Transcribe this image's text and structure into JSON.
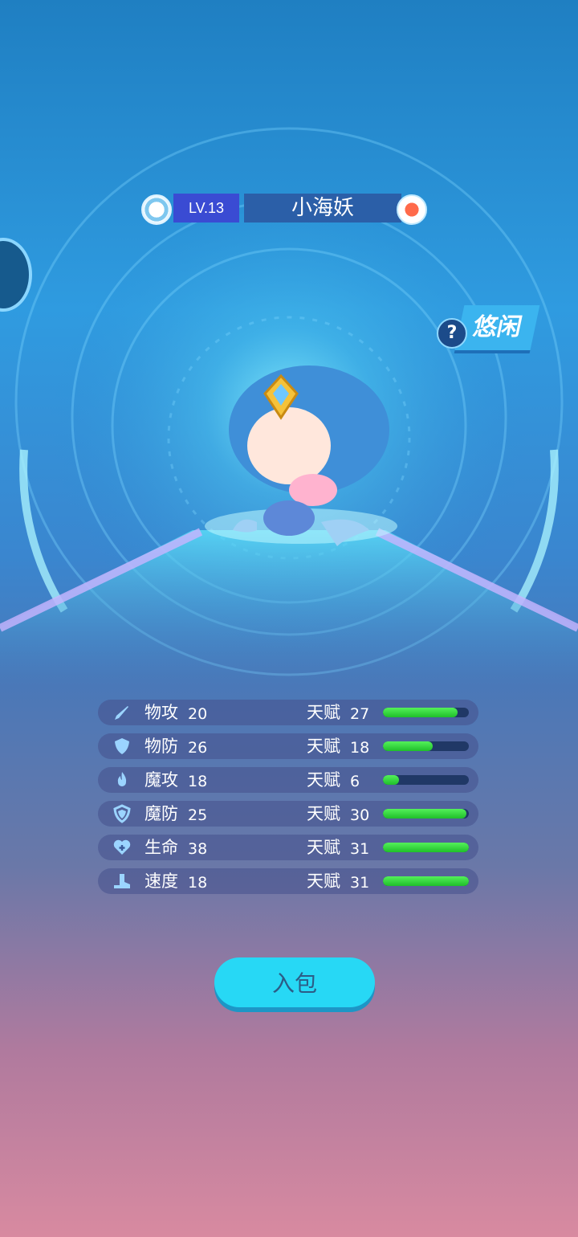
{
  "header": {
    "level": "LV.13",
    "pet_name": "小海妖",
    "left_icon": "element-icon",
    "right_icon": "gender-icon"
  },
  "state": {
    "help_icon": "?",
    "text": "悠闲"
  },
  "stats": [
    {
      "icon": "sword-icon",
      "name": "物攻",
      "value": "20",
      "talent_label": "天赋",
      "talent": "27",
      "talent_fraction": 0.87
    },
    {
      "icon": "shield-icon",
      "name": "物防",
      "value": "26",
      "talent_label": "天赋",
      "talent": "18",
      "talent_fraction": 0.58
    },
    {
      "icon": "flame-icon",
      "name": "魔攻",
      "value": "18",
      "talent_label": "天赋",
      "talent": "6",
      "talent_fraction": 0.19
    },
    {
      "icon": "magic-shield-icon",
      "name": "魔防",
      "value": "25",
      "talent_label": "天赋",
      "talent": "30",
      "talent_fraction": 0.97
    },
    {
      "icon": "heart-plus-icon",
      "name": "生命",
      "value": "38",
      "talent_label": "天赋",
      "talent": "31",
      "talent_fraction": 1.0
    },
    {
      "icon": "boot-icon",
      "name": "速度",
      "value": "18",
      "talent_label": "天赋",
      "talent": "31",
      "talent_fraction": 1.0
    }
  ],
  "actions": {
    "bag_label": "入包"
  },
  "colors": {
    "bar_fill": "#2ed636",
    "bar_track": "#203866",
    "button": "#27d8f5"
  }
}
